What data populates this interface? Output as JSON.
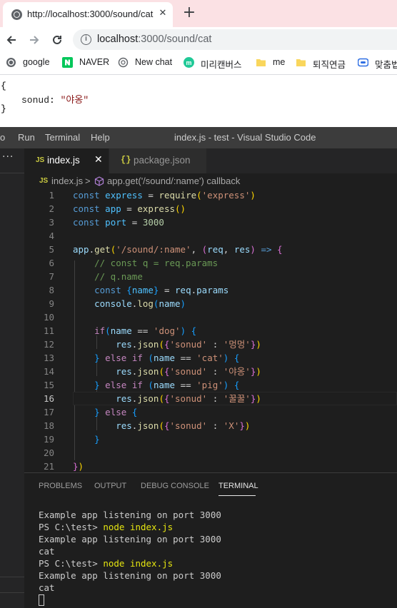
{
  "browser": {
    "tab_title": "http://localhost:3000/sound/cat",
    "tab_close": "✕",
    "new_tab": "+",
    "url_host": "localhost",
    "url_path": ":3000/sound/cat",
    "bookmarks": [
      {
        "label": "google",
        "icon": "globe-icon"
      },
      {
        "label": "NAVER",
        "icon": "naver-icon",
        "color": "#03c75a"
      },
      {
        "label": "New chat",
        "icon": "openai-icon"
      },
      {
        "label": "미리캔버스",
        "icon": "miricanvas-icon",
        "color": "#20c997"
      },
      {
        "label": "me",
        "icon": "folder-icon",
        "color": "#f9d65c"
      },
      {
        "label": "퇴직연금",
        "icon": "folder-icon",
        "color": "#f9d65c"
      },
      {
        "label": "맞춤법",
        "icon": "speller-icon",
        "color": "#2f6fe4"
      }
    ],
    "page_json": {
      "open": "{",
      "key": "sonud",
      "colon": ": ",
      "value": "\"야옹\"",
      "close": "}"
    }
  },
  "vscode": {
    "menu": [
      "o",
      "Run",
      "Terminal",
      "Help"
    ],
    "window_title": "index.js - test - Visual Studio Code",
    "side_dots": "···",
    "tabs": [
      {
        "label": "index.js",
        "badge": "JS",
        "close": "✕",
        "active": true
      },
      {
        "label": "package.json",
        "badge": "{}",
        "active": false
      }
    ],
    "breadcrumb": {
      "file_badge": "JS",
      "file": "index.js",
      "separator": ">",
      "symbol": "app.get('/sound/:name') callback"
    },
    "line_numbers": [
      "1",
      "2",
      "3",
      "4",
      "5",
      "6",
      "7",
      "8",
      "9",
      "10",
      "11",
      "12",
      "13",
      "14",
      "15",
      "16",
      "17",
      "18",
      "19",
      "20",
      "21"
    ],
    "current_line": 16,
    "panel_tabs": [
      "PROBLEMS",
      "OUTPUT",
      "DEBUG CONSOLE",
      "TERMINAL"
    ],
    "terminal": [
      "Example app listening on port 3000",
      "PS C:\\test> ",
      "node index.js",
      "Example app listening on port 3000",
      "cat",
      "PS C:\\test> ",
      "node index.js",
      "Example app listening on port 3000",
      "cat"
    ]
  },
  "code_tokens": {
    "const": "const",
    "express": "express",
    "eq": " = ",
    "require": "require",
    "express_str": "'express'",
    "app": "app",
    "port": "port",
    "port_num": "3000",
    "get": "get",
    "route": "'/sound/:name'",
    "req": "req",
    "res": "res",
    "arrow": "=>",
    "c1": "// const q = req.params",
    "c2": "// q.name",
    "name": "name",
    "params": "params",
    "console": "console",
    "log": "log",
    "if": "if",
    "else": "else",
    "json": "json",
    "sonud_key": "'sonud'",
    "dog": "'dog'",
    "cat": "'cat'",
    "pig": "'pig'",
    "v_dog": "'멍멍'",
    "v_cat": "'야옹'",
    "v_pig": "'꿀꿀'",
    "v_x": "'X'",
    "eqeq": " == "
  }
}
